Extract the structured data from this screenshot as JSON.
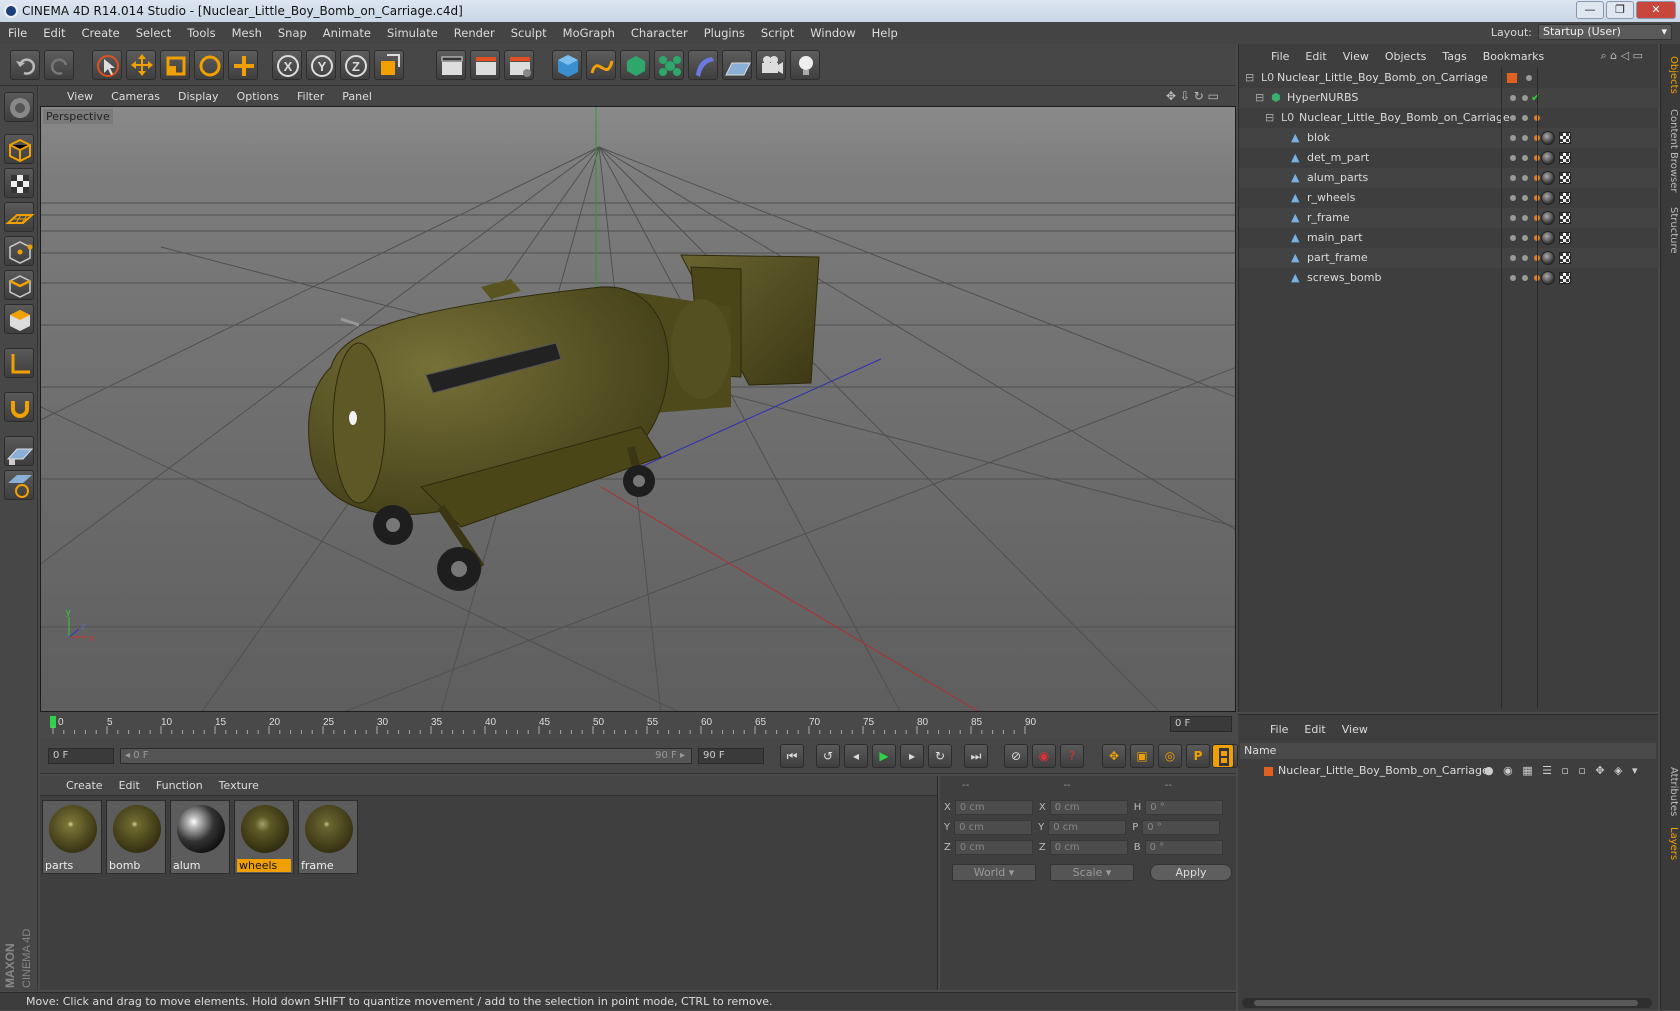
{
  "window": {
    "title": "CINEMA 4D R14.014 Studio - [Nuclear_Little_Boy_Bomb_on_Carriage.c4d]",
    "minimize": "—",
    "maximize": "❐",
    "close": "✕"
  },
  "menu": [
    "File",
    "Edit",
    "Create",
    "Select",
    "Tools",
    "Mesh",
    "Snap",
    "Animate",
    "Simulate",
    "Render",
    "Sculpt",
    "MoGraph",
    "Character",
    "Plugins",
    "Script",
    "Window",
    "Help"
  ],
  "layout": {
    "label": "Layout:",
    "value": "Startup (User)"
  },
  "toolbar": {
    "x_label": "X",
    "y_label": "Y",
    "z_label": "Z"
  },
  "viewport": {
    "menu": [
      "View",
      "Cameras",
      "Display",
      "Options",
      "Filter",
      "Panel"
    ],
    "label": "Perspective",
    "axis": {
      "x": "x",
      "y": "y",
      "z": "z"
    }
  },
  "timeline": {
    "ticks": [
      "0",
      "5",
      "10",
      "15",
      "20",
      "25",
      "30",
      "35",
      "40",
      "45",
      "50",
      "55",
      "60",
      "65",
      "70",
      "75",
      "80",
      "85",
      "90"
    ],
    "current_frame": "0 F"
  },
  "playback": {
    "start": "0 F",
    "range_start": "◂ 0 F",
    "range_end": "90 F ▸",
    "end": "90 F",
    "p_label": "P"
  },
  "materials": {
    "menu": [
      "Create",
      "Edit",
      "Function",
      "Texture"
    ],
    "items": [
      {
        "name": "parts"
      },
      {
        "name": "bomb"
      },
      {
        "name": "alum"
      },
      {
        "name": "wheels"
      },
      {
        "name": "frame"
      }
    ]
  },
  "coords": {
    "header": [
      "--",
      "--",
      "--"
    ],
    "rows": [
      {
        "a": "X",
        "av": "0 cm",
        "b": "X",
        "bv": "0 cm",
        "c": "H",
        "cv": "0 °"
      },
      {
        "a": "Y",
        "av": "0 cm",
        "b": "Y",
        "bv": "0 cm",
        "c": "P",
        "cv": "0 °"
      },
      {
        "a": "Z",
        "av": "0 cm",
        "b": "Z",
        "bv": "0 cm",
        "c": "B",
        "cv": "0 °"
      }
    ],
    "world": "World",
    "scale": "Scale",
    "apply": "Apply"
  },
  "status": "Move: Click and drag to move elements. Hold down SHIFT to quantize movement / add to the selection in point mode, CTRL to remove.",
  "objects": {
    "menu": [
      "File",
      "Edit",
      "View",
      "Objects",
      "Tags",
      "Bookmarks"
    ],
    "rows": [
      {
        "name": "Nuclear_Little_Boy_Bomb_on_Carriage",
        "indent": 0
      },
      {
        "name": "HyperNURBS",
        "indent": 1
      },
      {
        "name": "Nuclear_Little_Boy_Bomb_on_Carriage",
        "indent": 2
      },
      {
        "name": "blok",
        "indent": 3
      },
      {
        "name": "det_m_part",
        "indent": 3
      },
      {
        "name": "alum_parts",
        "indent": 3
      },
      {
        "name": "r_wheels",
        "indent": 3
      },
      {
        "name": "r_frame",
        "indent": 3
      },
      {
        "name": "main_part",
        "indent": 3
      },
      {
        "name": "part_frame",
        "indent": 3
      },
      {
        "name": "screws_bomb",
        "indent": 3
      }
    ]
  },
  "sidetabs": [
    "Objects",
    "Content Browser",
    "Structure",
    "Attributes",
    "Layers"
  ],
  "layers": {
    "menu": [
      "File",
      "Edit",
      "View"
    ],
    "header_name": "Name",
    "header_cols": [
      "S",
      "V",
      "R",
      "M",
      "L",
      "A",
      "G",
      "D",
      "E"
    ],
    "row": "Nuclear_Little_Boy_Bomb_on_Carriage"
  },
  "brand": {
    "maxon": "MAXON",
    "c4d": "CINEMA 4D"
  },
  "colors": {
    "accent": "#f0a000",
    "bomb": "#5f5a24",
    "grid": "#5a5a5a"
  }
}
